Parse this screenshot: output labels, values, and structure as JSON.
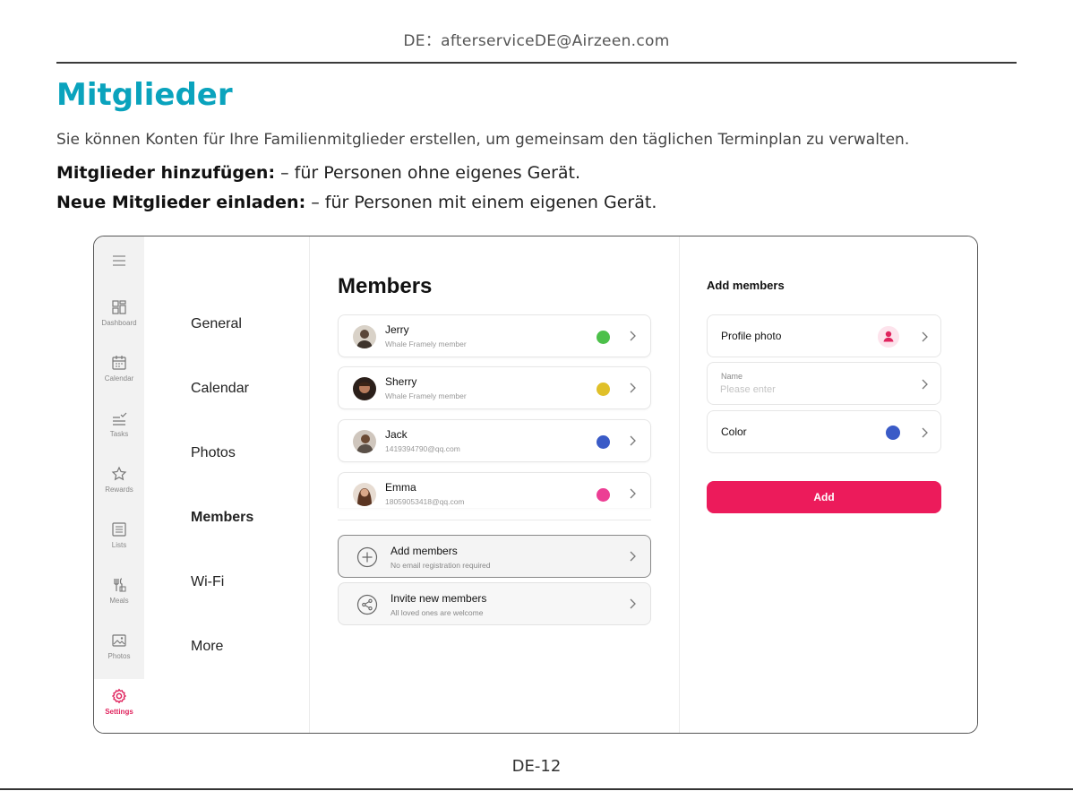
{
  "manual": {
    "contact_email": "DE：afterserviceDE@Airzeen.com",
    "title": "Mitglieder",
    "intro": "Sie können Konten für Ihre Familienmitglieder erstellen, um gemeinsam den täglichen Terminplan zu verwalten.",
    "add_term": "Mitglieder hinzufügen:",
    "add_desc": " – für Personen ohne eigenes Gerät.",
    "invite_term": "Neue Mitglieder einladen:",
    "invite_desc": " – für Personen mit einem eigenen Gerät.",
    "page_number": "DE-12"
  },
  "rail": {
    "items": [
      {
        "label": "Dashboard",
        "icon": "dashboard-icon"
      },
      {
        "label": "Calendar",
        "icon": "calendar-icon"
      },
      {
        "label": "Tasks",
        "icon": "tasks-icon"
      },
      {
        "label": "Rewards",
        "icon": "star-icon"
      },
      {
        "label": "Lists",
        "icon": "list-icon"
      },
      {
        "label": "Meals",
        "icon": "meals-icon"
      },
      {
        "label": "Photos",
        "icon": "photo-icon"
      },
      {
        "label": "Settings",
        "icon": "gear-icon",
        "active": true
      }
    ]
  },
  "settings_menu": {
    "items": [
      "General",
      "Calendar",
      "Photos",
      "Members",
      "Wi-Fi",
      "More"
    ],
    "active": "Members"
  },
  "members": {
    "title": "Members",
    "list": [
      {
        "name": "Jerry",
        "subtitle": "Whale Framely member",
        "color": "#4cc04a"
      },
      {
        "name": "Sherry",
        "subtitle": "Whale Framely member",
        "color": "#e0c029"
      },
      {
        "name": "Jack",
        "subtitle": "1419394790@qq.com",
        "color": "#3a5bc7"
      },
      {
        "name": "Emma",
        "subtitle": "18059053418@qq.com",
        "color": "#ec3e94"
      }
    ],
    "actions": [
      {
        "title": "Add members",
        "subtitle": "No email registration required",
        "icon": "plus-circle-icon"
      },
      {
        "title": "Invite new members",
        "subtitle": "All loved ones are welcome",
        "icon": "share-icon"
      }
    ]
  },
  "add_panel": {
    "title": "Add members",
    "profile_label": "Profile photo",
    "name_label": "Name",
    "name_placeholder": "Please enter",
    "color_label": "Color",
    "color_value": "#3a5bc7",
    "button": "Add",
    "accent": "#ec1b5b"
  }
}
